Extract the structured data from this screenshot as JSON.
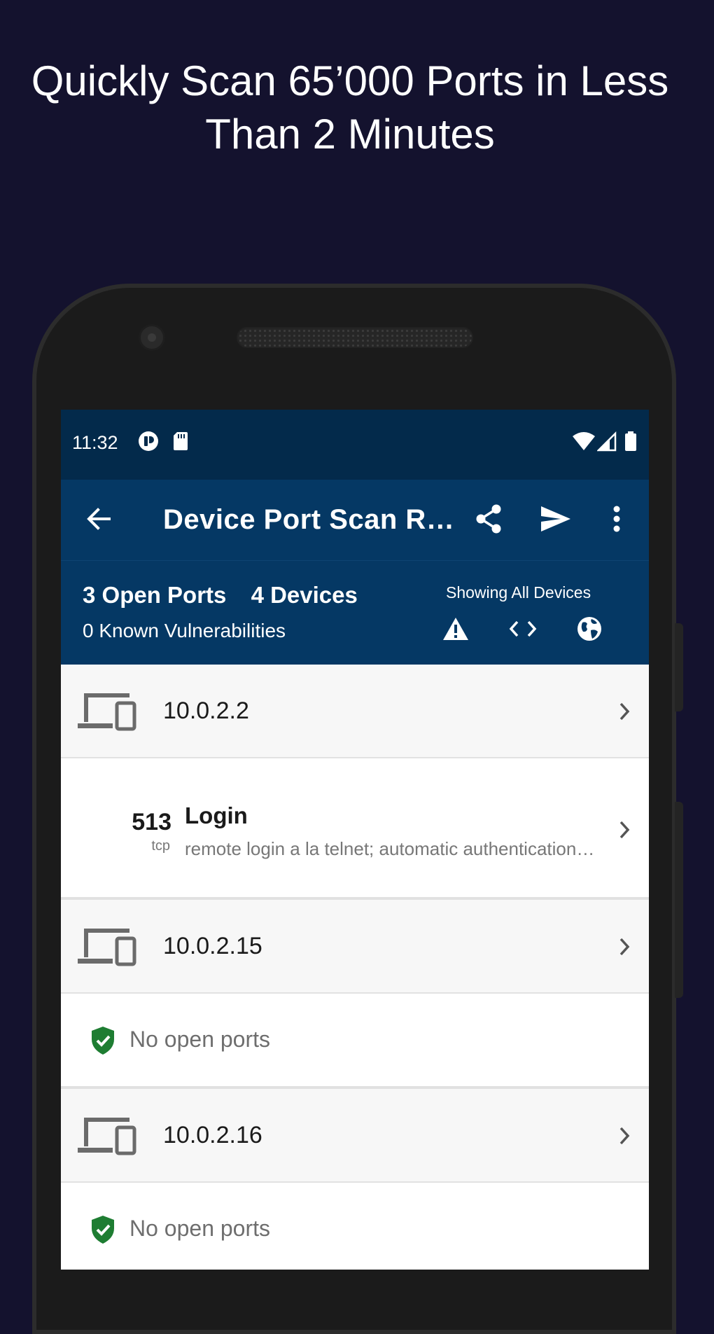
{
  "headline": {
    "line1": "Quickly Scan 65’000 Ports in Less",
    "line2": "Than 2 Minutes"
  },
  "status_bar": {
    "time": "11:32",
    "icons": [
      "notification-app-icon",
      "sd-card-icon",
      "wifi-icon",
      "cell-signal-icon",
      "battery-icon"
    ]
  },
  "app_bar": {
    "title": "Device Port Scan R…",
    "icons": [
      "back-arrow-icon",
      "share-icon",
      "send-icon",
      "more-vert-icon"
    ]
  },
  "summary": {
    "open_ports": "3 Open Ports",
    "devices": "4 Devices",
    "vulnerabilities": "0 Known Vulnerabilities",
    "showing": "Showing All Devices",
    "filter_icons": [
      "warning-icon",
      "code-icon",
      "globe-icon"
    ]
  },
  "devices": [
    {
      "ip": "10.0.2.2",
      "ports": [
        {
          "number": "513",
          "protocol": "tcp",
          "name": "Login",
          "description": "remote login a la telnet; automatic authentication performed"
        }
      ]
    },
    {
      "ip": "10.0.2.15",
      "no_ports_text": "No open ports"
    },
    {
      "ip": "10.0.2.16",
      "no_ports_text": "No open ports"
    }
  ],
  "colors": {
    "page_background": "#14122e",
    "status_bar": "#032a4b",
    "app_bar": "#053864",
    "safe_green": "#1e7d32"
  }
}
